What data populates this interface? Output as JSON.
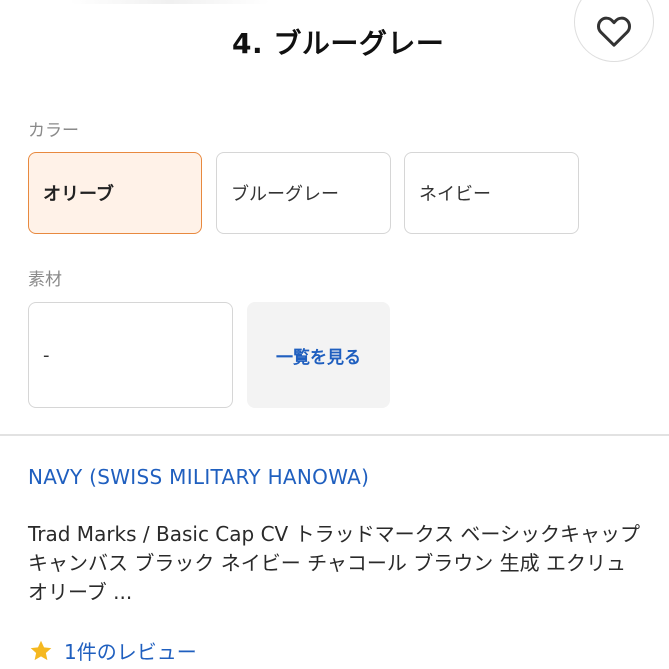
{
  "product": {
    "variant_title": "4. ブルーグレー"
  },
  "favorite": {
    "icon": "heart-outline-icon"
  },
  "color_section": {
    "label": "カラー",
    "options": [
      {
        "label": "オリーブ",
        "selected": true
      },
      {
        "label": "ブルーグレー",
        "selected": false
      },
      {
        "label": "ネイビー",
        "selected": false
      }
    ]
  },
  "material_section": {
    "label": "素材",
    "value": "-",
    "view_all_label": "一覧を見る"
  },
  "listing": {
    "shop_name": "NAVY (SWISS MILITARY HANOWA)",
    "product_name": "Trad Marks / Basic Cap CV トラッドマークス ベーシックキャップ キャンバス ブラック ネイビー チャコール ブラウン 生成 エクリュ オリーブ ...",
    "review_label": "1件のレビュー",
    "review_icon": "star-icon"
  },
  "colors": {
    "accent_orange": "#e8893f",
    "selected_bg": "#fff2e8",
    "link_blue": "#1f5fbf",
    "star_yellow": "#f5b820"
  }
}
